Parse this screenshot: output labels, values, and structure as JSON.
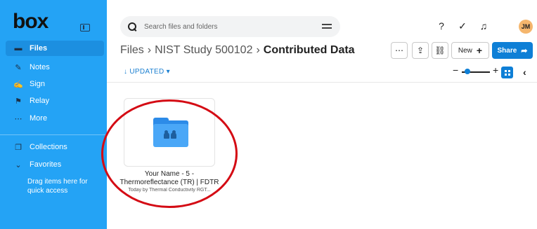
{
  "brand": {
    "logo": "box"
  },
  "sidebar": {
    "items": [
      {
        "label": "Files",
        "icon": "folder-icon",
        "active": true
      },
      {
        "label": "Notes",
        "icon": "notes-icon"
      },
      {
        "label": "Sign",
        "icon": "sign-icon"
      },
      {
        "label": "Relay",
        "icon": "relay-icon"
      },
      {
        "label": "More",
        "icon": "more-icon"
      },
      {
        "label": "Collections",
        "icon": "collections-icon"
      },
      {
        "label": "Favorites",
        "icon": "chevron-down-icon"
      }
    ],
    "drag_hint": "Drag items here for quick access"
  },
  "search": {
    "placeholder": "Search files and folders"
  },
  "header": {
    "avatar_initials": "JM"
  },
  "breadcrumb": {
    "root": "Files",
    "parent": "NIST Study 500102",
    "current": "Contributed Data"
  },
  "toolbar": {
    "new_label": "New",
    "share_label": "Share"
  },
  "sort": {
    "label": "↓ UPDATED ▾"
  },
  "file": {
    "title": "Your Name - 5 - Thermoreflectance (TR) | FDTR",
    "meta": "Today by Thermal Conductivity RGT..."
  },
  "colors": {
    "sidebar": "#24a3f5",
    "accent": "#0e7fd6",
    "highlight": "#d40b14",
    "avatar": "#f5b66d"
  }
}
